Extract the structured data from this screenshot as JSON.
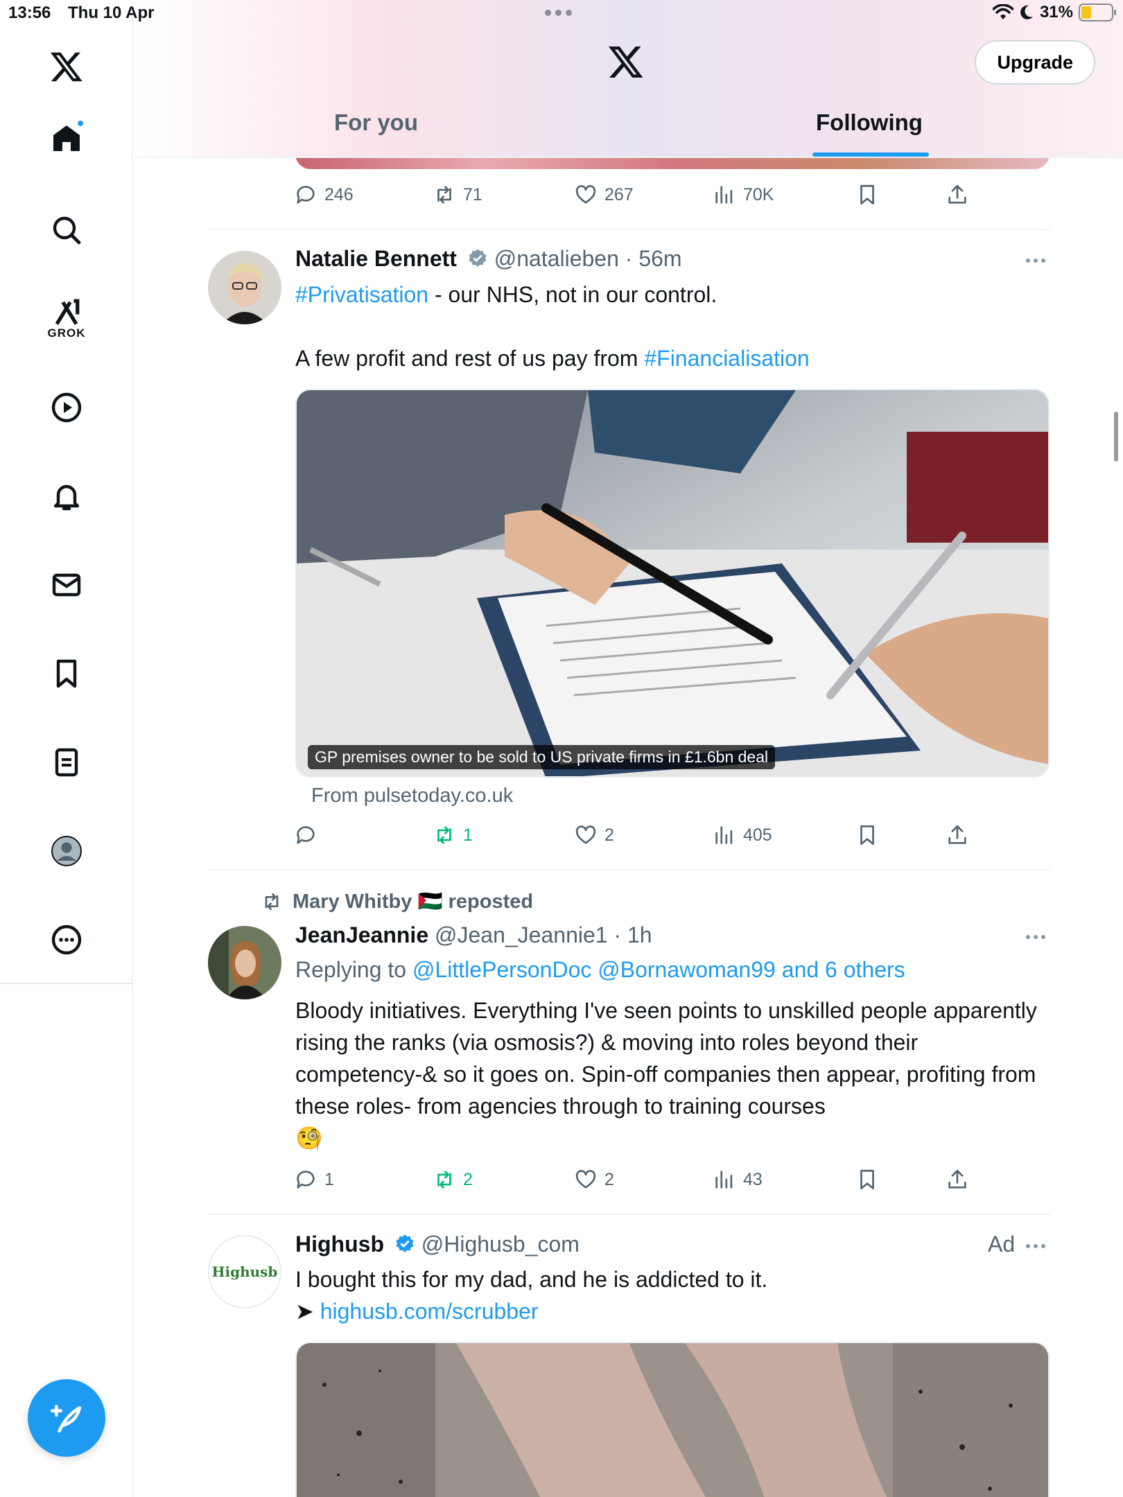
{
  "status_bar": {
    "time": "13:56",
    "date": "Thu 10 Apr",
    "battery": "31%"
  },
  "header": {
    "upgrade_label": "Upgrade",
    "tabs": [
      {
        "label": "For you"
      },
      {
        "label": "Following"
      }
    ]
  },
  "nav": {
    "grok_label": "GROK"
  },
  "prev_tweet": {
    "replies": "246",
    "reposts": "71",
    "likes": "267",
    "views": "70K"
  },
  "tweets": [
    {
      "name": "Natalie Bennett",
      "handle": "@natalieben",
      "time": "· 56m",
      "hashtag1": "#Privatisation",
      "text1_rest": " - our NHS, not in our control.",
      "text2_pre": "A few profit and rest of us pay from ",
      "hashtag2": "#Financialisation",
      "card_caption": "GP premises owner to be sold to US private firms in £1.6bn deal",
      "card_source": "From pulsetoday.co.uk",
      "replies": "",
      "reposts": "1",
      "likes": "2",
      "views": "405"
    },
    {
      "reposted_by": "Mary Whitby 🇵🇸 reposted",
      "name": "JeanJeannie",
      "handle": "@Jean_Jeannie1",
      "time": "· 1h",
      "replying_prefix": "Replying to ",
      "replying_to": "@LittlePersonDoc @Bornawoman99 and 6 others",
      "text": "Bloody initiatives. Everything I've seen points to unskilled people apparently rising the ranks (via osmosis?) & moving into roles beyond their competency-& so it goes on. Spin-off companies then appear, profiting from these roles- from agencies through to training courses",
      "emoji": "🧐",
      "replies": "1",
      "reposts": "2",
      "likes": "2",
      "views": "43"
    },
    {
      "name": "Highusb",
      "handle": "@Highusb_com",
      "ad_label": "Ad",
      "avatar_text": "Highusb",
      "text": "I bought this for my dad, and he is addicted to it.",
      "arrow": "➤ ",
      "link": "highusb.com/scrubber"
    }
  ],
  "colors": {
    "accent": "#1d9bf0",
    "repost_green": "#00ba7c",
    "secondary_text": "#536471"
  }
}
